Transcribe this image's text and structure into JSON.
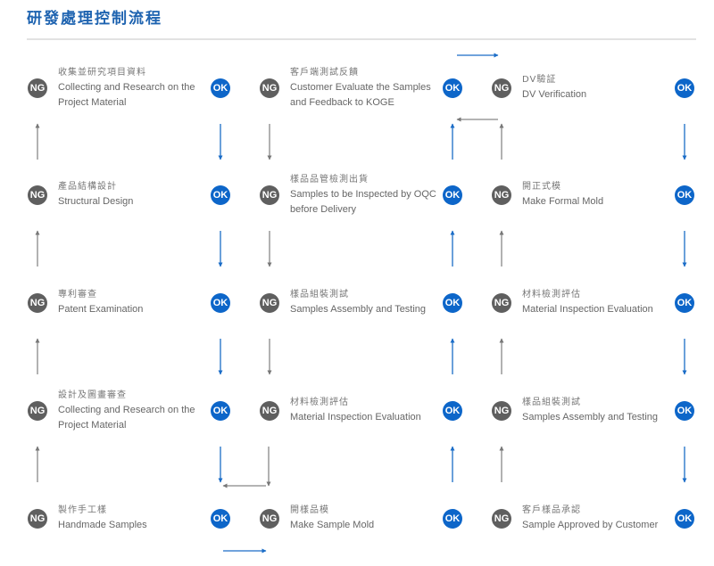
{
  "title": "研發處理控制流程",
  "colors": {
    "accent": "#1e63b0",
    "ok": "#0d66c9",
    "ng": "#5f5f5f",
    "ng_arrow": "#777777",
    "ok_arrow": "#1a6cc7"
  },
  "labels": {
    "ng": "NG",
    "ok": "OK"
  },
  "columns": [
    {
      "steps": [
        {
          "zh": "收集並研究項目資料",
          "en": "Collecting and Research on the Project Material"
        },
        {
          "zh": "產品結構設計",
          "en": "Structural Design"
        },
        {
          "zh": "專利審查",
          "en": "Patent Examination"
        },
        {
          "zh": "設計及圖畫審查",
          "en": "Collecting and Research on the Project Material"
        },
        {
          "zh": "製作手工樣",
          "en": "Handmade Samples"
        }
      ]
    },
    {
      "steps": [
        {
          "zh": "客戶端測試反饋",
          "en": "Customer Evaluate the Samples and Feedback to KOGE"
        },
        {
          "zh": "樣品品管檢測出貨",
          "en": "Samples to be Inspected by OQC before Delivery"
        },
        {
          "zh": "樣品組裝測試",
          "en": "Samples Assembly and Testing"
        },
        {
          "zh": "材料檢測評估",
          "en": "Material Inspection Evaluation"
        },
        {
          "zh": "開樣品模",
          "en": "Make Sample Mold"
        }
      ]
    },
    {
      "steps": [
        {
          "zh": "DV驗証",
          "en": "DV Verification"
        },
        {
          "zh": "開正式模",
          "en": "Make Formal Mold"
        },
        {
          "zh": "材料檢測評估",
          "en": "Material Inspection Evaluation"
        },
        {
          "zh": "樣品組裝測試",
          "en": "Samples Assembly and Testing"
        },
        {
          "zh": "客戶樣品承認",
          "en": "Sample Approved by Customer"
        }
      ]
    }
  ]
}
